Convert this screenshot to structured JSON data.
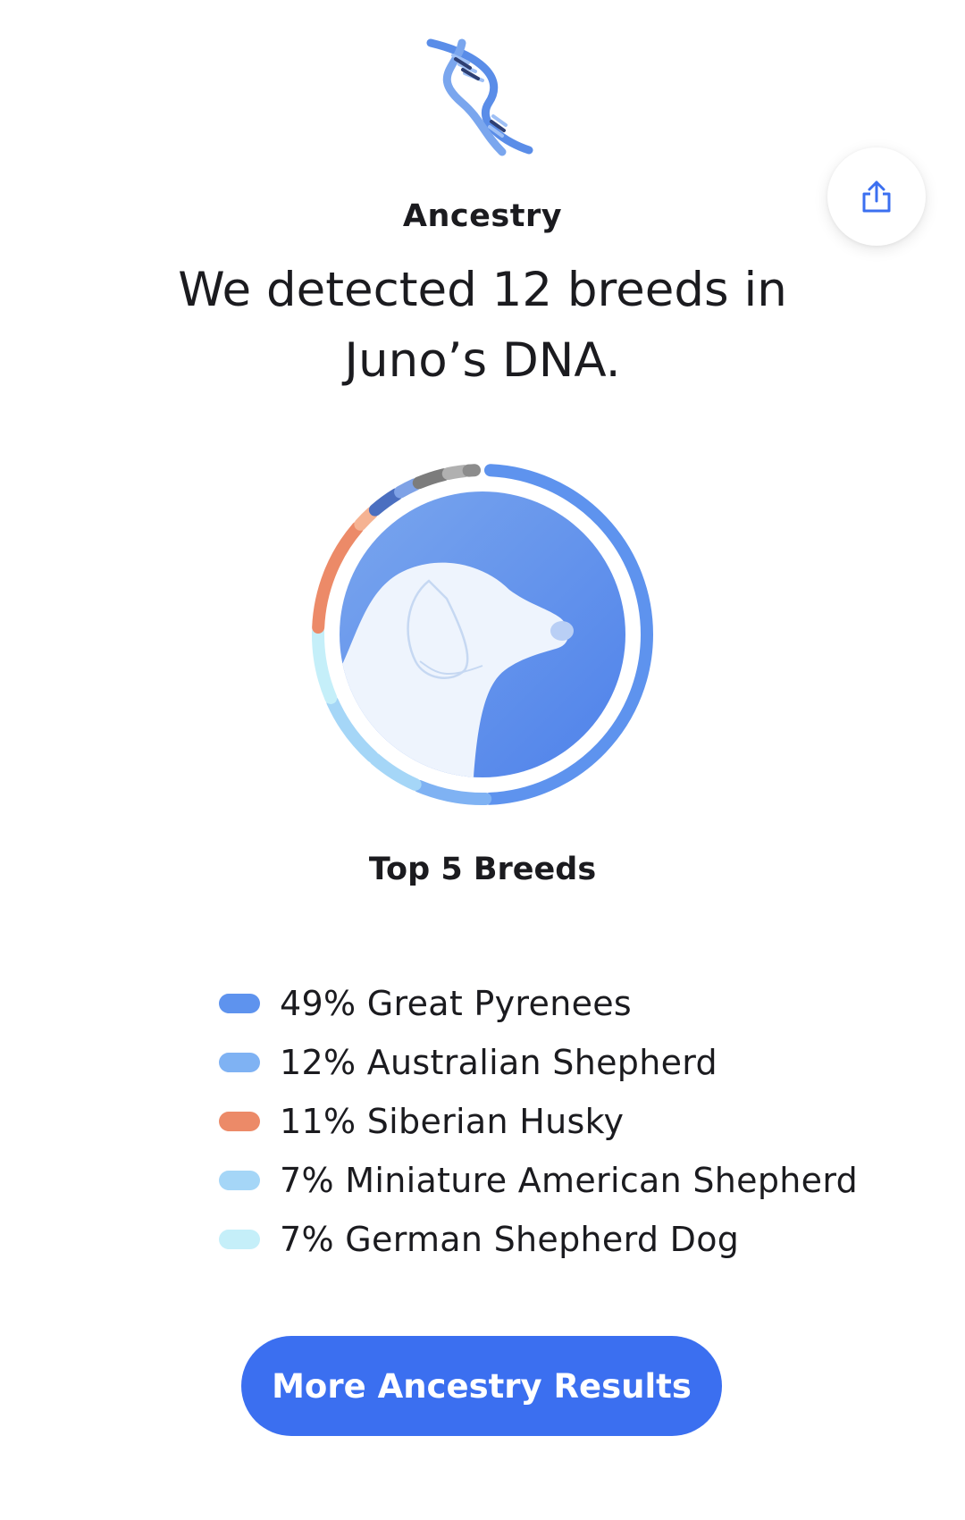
{
  "header": {
    "icon": "dna-icon",
    "section_label": "Ancestry",
    "headline": "We detected 12 breeds in Juno’s DNA.",
    "share_icon": "share-icon"
  },
  "colors": {
    "great_pyrenees": "#5e93ee",
    "australian_shepherd": "#7fb2f3",
    "siberian_husky": "#ec8a68",
    "miniature_american_shepherd": "#a5d6f7",
    "german_shepherd_dog": "#c5eff9",
    "accent": "#3b6ff0"
  },
  "chart_data": {
    "type": "pie",
    "variant": "donut",
    "categories": [
      "Great Pyrenees",
      "Australian Shepherd",
      "Siberian Husky",
      "Miniature American Shepherd",
      "German Shepherd Dog"
    ],
    "values": [
      49,
      12,
      11,
      7,
      7
    ],
    "unit": "%",
    "segments": [
      {
        "value": 49,
        "color": "#5e93ee"
      },
      {
        "value": 7,
        "color": "#7fb2f3"
      },
      {
        "value": 5,
        "color": "#a5d6f7"
      },
      {
        "value": 7,
        "color": "#a5d6f7"
      },
      {
        "value": 7,
        "color": "#c5eff9"
      },
      {
        "value": 11,
        "color": "#ec8a68"
      },
      {
        "value": 2,
        "color": "#f5b393"
      },
      {
        "value": 3,
        "color": "#4b6fc0"
      },
      {
        "value": 2,
        "color": "#7fa2e6"
      },
      {
        "value": 3,
        "color": "#7c7c7c"
      },
      {
        "value": 2,
        "color": "#b0b0b0"
      },
      {
        "value": 1,
        "color": "#8c8c8c"
      }
    ],
    "center_image": "dog-head-icon"
  },
  "breakdown": {
    "title": "Top 5 Breeds",
    "items": [
      {
        "label": "49% Great Pyrenees",
        "color": "#5e93ee"
      },
      {
        "label": "12% Australian Shepherd",
        "color": "#7fb2f3"
      },
      {
        "label": "11% Siberian Husky",
        "color": "#ec8a68"
      },
      {
        "label": "7% Miniature American Shepherd",
        "color": "#a5d6f7"
      },
      {
        "label": "7% German Shepherd Dog",
        "color": "#c5eff9"
      }
    ]
  },
  "cta": {
    "label": "More Ancestry Results"
  }
}
